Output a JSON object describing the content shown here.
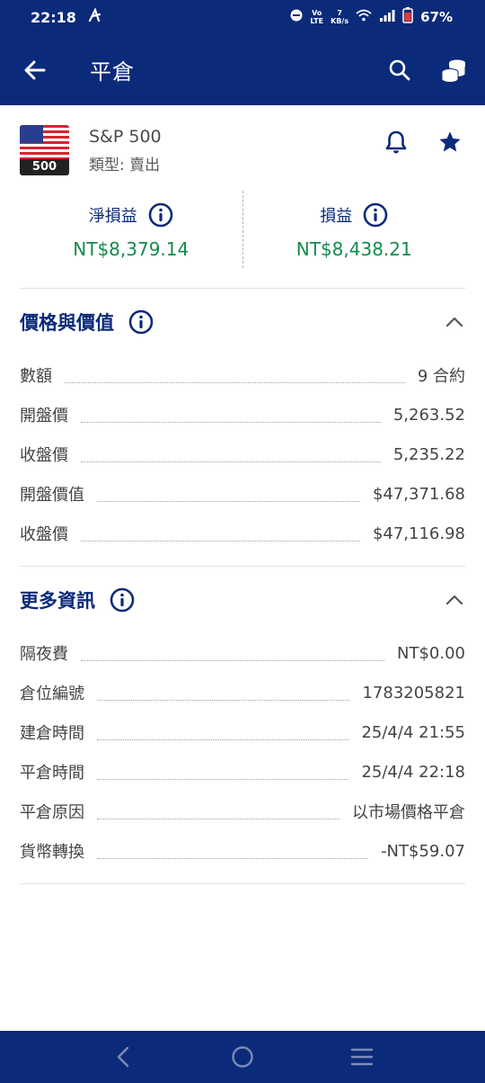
{
  "status_bar": {
    "time": "22:18",
    "net_top": "Vo",
    "net_bottom": "LTE",
    "speed_top": "7",
    "speed_bottom": "KB/s",
    "battery": "67%"
  },
  "app_bar": {
    "title": "平倉"
  },
  "instrument": {
    "name": "S&P 500",
    "badge": "500",
    "type": "類型: 賣出"
  },
  "pnl": {
    "net_label": "淨損益",
    "net_value": "NT$8,379.14",
    "gross_label": "損益",
    "gross_value": "NT$8,438.21",
    "value_color": "#138a4c"
  },
  "price_section": {
    "title": "價格與價值",
    "rows": [
      {
        "label": "數額",
        "value": "9 合約"
      },
      {
        "label": "開盤價",
        "value": "5,263.52"
      },
      {
        "label": "收盤價",
        "value": "5,235.22"
      },
      {
        "label": "開盤價值",
        "value": "$47,371.68"
      },
      {
        "label": "收盤價",
        "value": "$47,116.98"
      }
    ]
  },
  "more_section": {
    "title": "更多資訊",
    "rows": [
      {
        "label": "隔夜費",
        "value": "NT$0.00"
      },
      {
        "label": "倉位編號",
        "value": "1783205821"
      },
      {
        "label": "建倉時間",
        "value": "25/4/4 21:55"
      },
      {
        "label": "平倉時間",
        "value": "25/4/4 22:18"
      },
      {
        "label": "平倉原因",
        "value": "以市場價格平倉"
      },
      {
        "label": "貨幣轉換",
        "value": "-NT$59.07"
      }
    ]
  },
  "colors": {
    "primary": "#0b2a7a",
    "positive": "#138a4c"
  },
  "icons": [
    "back-arrow-icon",
    "search-icon",
    "coins-icon",
    "bell-icon",
    "star-icon",
    "info-icon",
    "chevron-up-icon",
    "nav-back-icon",
    "nav-home-icon",
    "nav-recents-icon"
  ]
}
